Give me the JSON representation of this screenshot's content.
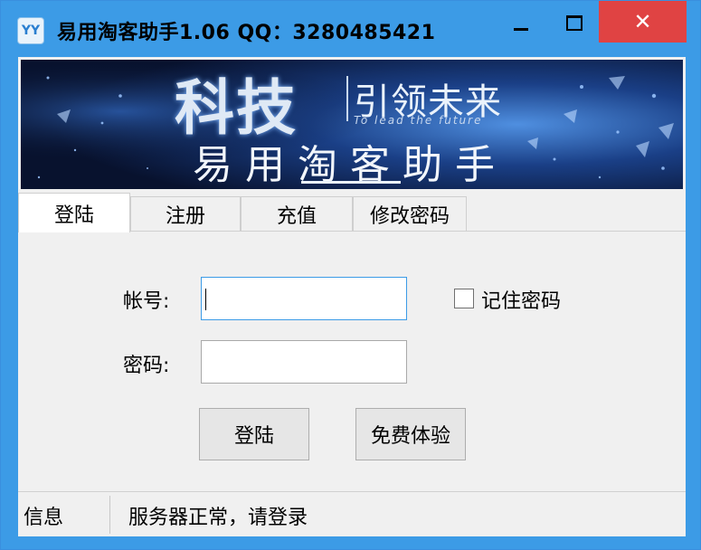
{
  "window": {
    "title": "易用淘客助手1.06  QQ：3280485421",
    "icon_name": "app-logo-icon",
    "icon_glyph": "YY",
    "close_glyph": "✕",
    "accent_color": "#3c9be6",
    "close_color": "#e04343"
  },
  "banner": {
    "headline": "科技",
    "tagline": "引领未来",
    "tagline_en": "To lead the future",
    "product_name": "易用淘客助手"
  },
  "tabs": [
    {
      "label": "登陆",
      "active": true
    },
    {
      "label": "注册",
      "active": false
    },
    {
      "label": "充值",
      "active": false
    },
    {
      "label": "修改密码",
      "active": false
    }
  ],
  "login_form": {
    "account_label": "帐号:",
    "account_value": "",
    "password_label": "密码:",
    "password_value": "",
    "remember_label": "记住密码",
    "remember_checked": false,
    "login_button": "登陆",
    "trial_button": "免费体验"
  },
  "statusbar": {
    "label": "信息",
    "message": "服务器正常，请登录"
  }
}
